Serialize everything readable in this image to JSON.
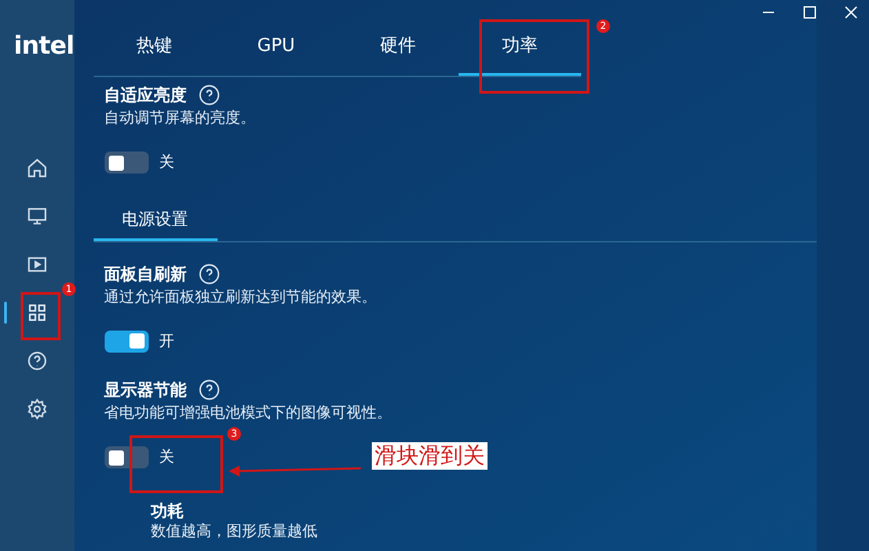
{
  "brand": "intel",
  "sidebar": {
    "items": [
      {
        "kind": "home",
        "selected": false
      },
      {
        "kind": "display",
        "selected": false
      },
      {
        "kind": "video",
        "selected": false
      },
      {
        "kind": "apps",
        "selected": true
      },
      {
        "kind": "help",
        "selected": false
      },
      {
        "kind": "settings",
        "selected": false
      }
    ]
  },
  "tabs": [
    {
      "label": "热键",
      "selected": false
    },
    {
      "label": "GPU",
      "selected": false
    },
    {
      "label": "硬件",
      "selected": false
    },
    {
      "label": "功率",
      "selected": true
    }
  ],
  "settings_top": {
    "title": "自适应亮度",
    "description": "自动调节屏幕的亮度。",
    "on": false,
    "state_label": "关"
  },
  "section_tab": {
    "label": "电源设置",
    "selected": true
  },
  "settings": [
    {
      "title": "面板自刷新",
      "description": "通过允许面板独立刷新达到节能的效果。",
      "on": true,
      "state_label": "开"
    },
    {
      "title": "显示器节能",
      "description": "省电功能可增强电池模式下的图像可视性。",
      "on": false,
      "state_label": "关"
    }
  ],
  "power": {
    "title": "功耗",
    "description": "数值越高，图形质量越低"
  },
  "annotations": {
    "badges": [
      "1",
      "2",
      "3"
    ],
    "callout": "滑块滑到关"
  }
}
